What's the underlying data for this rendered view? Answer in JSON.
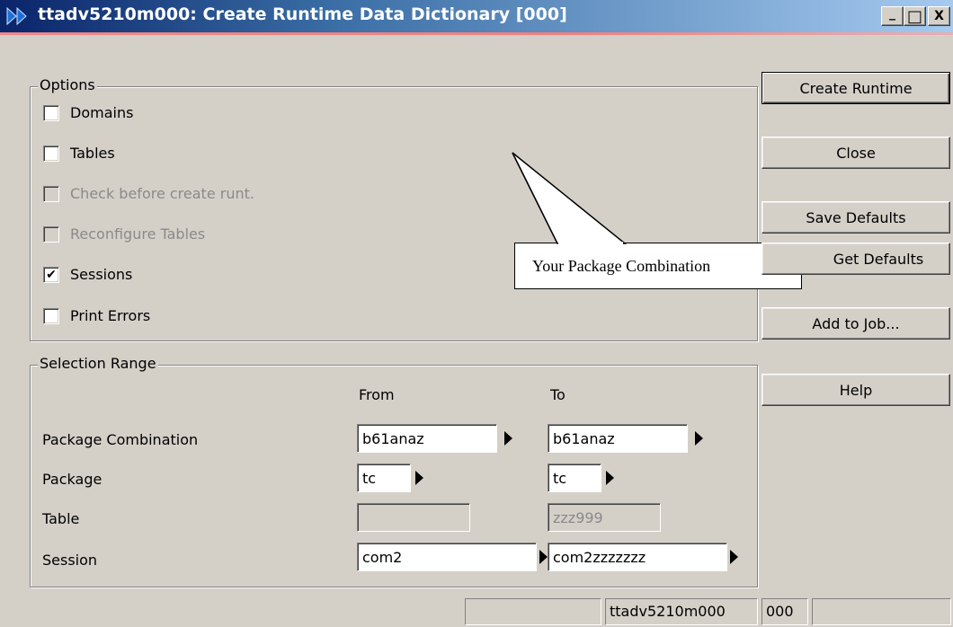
{
  "window": {
    "title": "ttadv5210m000: Create Runtime Data Dictionary [000]",
    "minimize_glyph": "_",
    "maximize_glyph": "□",
    "close_glyph": "X"
  },
  "options": {
    "legend": "Options",
    "items": [
      {
        "label": "Domains",
        "checked": false,
        "enabled": true
      },
      {
        "label": "Tables",
        "checked": false,
        "enabled": true
      },
      {
        "label": "Check before create runt.",
        "checked": false,
        "enabled": false
      },
      {
        "label": "Reconfigure Tables",
        "checked": false,
        "enabled": false
      },
      {
        "label": "Sessions",
        "checked": true,
        "enabled": true
      },
      {
        "label": "Print Errors",
        "checked": false,
        "enabled": true
      }
    ]
  },
  "buttons": {
    "create_runtime": "Create Runtime",
    "close": "Close",
    "save_defaults": "Save Defaults",
    "get_defaults": "Get Defaults",
    "add_to_job": "Add to Job...",
    "help": "Help"
  },
  "callout": {
    "text": "Your Package Combination"
  },
  "selection": {
    "legend": "Selection Range",
    "from_header": "From",
    "to_header": "To",
    "rows": [
      {
        "label": "Package Combination",
        "from": "b61anaz",
        "to": "b61anaz"
      },
      {
        "label": "Package",
        "from": "tc",
        "to": "tc"
      },
      {
        "label": "Table",
        "from": "",
        "to": "zzz999"
      },
      {
        "label": "Session",
        "from": "com2",
        "to": "com2zzzzzzz"
      }
    ]
  },
  "statusbar": {
    "cell1": "",
    "cell2": "ttadv5210m000",
    "cell3": "000",
    "cell4": ""
  },
  "colors": {
    "face": "#d4d0c8",
    "title_start": "#0a246a",
    "title_end": "#a6caf0",
    "icon_blue": "#1e6fd9"
  }
}
